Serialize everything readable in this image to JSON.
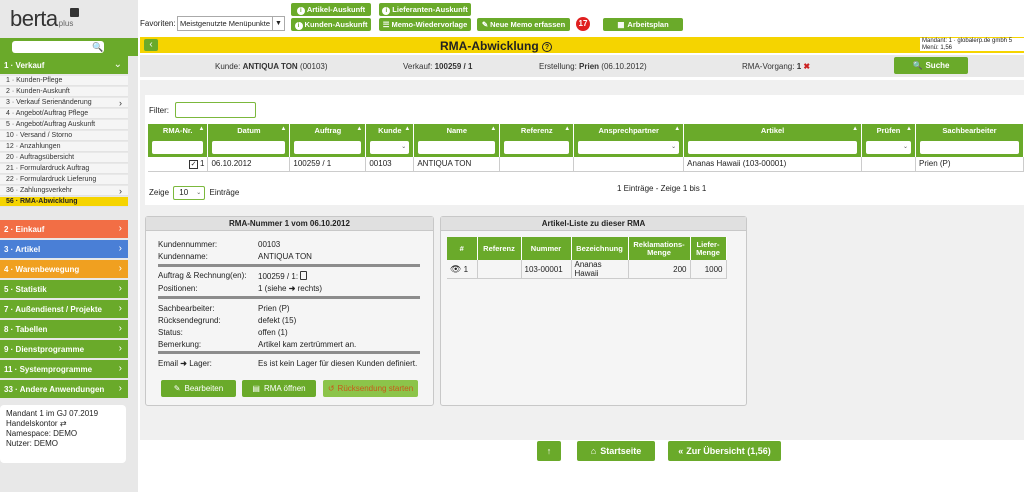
{
  "logo": {
    "text": "berta",
    "suffix": "plus"
  },
  "sidebar": {
    "sections": [
      {
        "label": "1 · Verkauf",
        "color": "#6aaa2a",
        "expanded": true
      },
      {
        "label": "2 · Einkauf",
        "color": "#f26e45"
      },
      {
        "label": "3 · Artikel",
        "color": "#4a7fd6"
      },
      {
        "label": "4 · Warenbewegung",
        "color": "#f0a020"
      },
      {
        "label": "5 · Statistik",
        "color": "#6aaa2a"
      },
      {
        "label": "7 · Außendienst / Projekte",
        "color": "#6aaa2a"
      },
      {
        "label": "8 · Tabellen",
        "color": "#6aaa2a"
      },
      {
        "label": "9 · Dienstprogramme",
        "color": "#6aaa2a"
      },
      {
        "label": "11 · Systemprogramme",
        "color": "#6aaa2a"
      },
      {
        "label": "33 · Andere Anwendungen",
        "color": "#6aaa2a"
      }
    ],
    "items": [
      {
        "label": "1 · Kunden-Pflege"
      },
      {
        "label": "2 · Kunden-Auskunft"
      },
      {
        "label": "3 · Verkauf Serienänderung",
        "chevron": true
      },
      {
        "label": "4 · Angebot/Auftrag Pflege"
      },
      {
        "label": "5 · Angebot/Auftrag Auskunft"
      },
      {
        "label": "10 · Versand / Storno"
      },
      {
        "label": "12 · Anzahlungen"
      },
      {
        "label": "20 · Auftragsübersicht"
      },
      {
        "label": "21 · Formulardruck Auftrag"
      },
      {
        "label": "22 · Formulardruck Lieferung"
      },
      {
        "label": "36 · Zahlungsverkehr",
        "chevron": true
      },
      {
        "label": "56 · RMA-Abwicklung",
        "active": true
      }
    ],
    "user": {
      "line1": "Mandant 1 im GJ 07.2019",
      "line2": "Handelskontor",
      "line3": "Namespace: DEMO",
      "line4": "Nutzer: DEMO"
    }
  },
  "topbar": {
    "favoriten_label": "Favoriten:",
    "favoriten_value": "Meistgenutzte Menüpunkte",
    "btn_artikel": "Artikel-Auskunft",
    "btn_lieferanten": "Lieferanten-Auskunft",
    "btn_kunden": "Kunden-Auskunft",
    "btn_memo_wv": "Memo-Wiedervorlage",
    "btn_neue_memo": "Neue Memo erfassen",
    "memo_badge": "17",
    "btn_arbeitsplan": "Arbeitsplan"
  },
  "titlebar": {
    "title": "RMA-Abwicklung",
    "mandant_line1": "Mandant: 1 · globalerp.de gmbh 5",
    "mandant_line2": "Menü: 1,56"
  },
  "infobar": {
    "kunde_label": "Kunde:",
    "kunde_value": "ANTIQUA TON",
    "kunde_nr": "(00103)",
    "verkauf_label": "Verkauf:",
    "verkauf_value": "100259 / 1",
    "erstellung_label": "Erstellung:",
    "erstellung_value": "Prien",
    "erstellung_date": "(06.10.2012)",
    "rma_label": "RMA-Vorgang:",
    "rma_value": "1",
    "suche": "Suche"
  },
  "grid": {
    "filter_label": "Filter:",
    "columns": [
      "RMA-Nr.",
      "Datum",
      "Auftrag",
      "Kunde",
      "Name",
      "Referenz",
      "Ansprechpartner",
      "Artikel",
      "Prüfen",
      "Sachbearbeiter"
    ],
    "rows": [
      {
        "rma": "1",
        "datum": "06.10.2012",
        "auftrag": "100259 / 1",
        "kunde": "00103",
        "name": "ANTIQUA TON",
        "referenz": "",
        "ansprech": "",
        "artikel": "Ananas Hawaii (103-00001)",
        "pruefen": "",
        "sach": "Prien (P)"
      }
    ],
    "zeige_label": "Zeige",
    "zeige_value": "10",
    "eintraege_label": "Einträge",
    "info": "1 Einträge - Zeige 1 bis 1"
  },
  "rma_panel": {
    "title": "RMA-Nummer 1 vom 06.10.2012",
    "kundennummer_label": "Kundennummer:",
    "kundennummer": "00103",
    "kundenname_label": "Kundenname:",
    "kundenname": "ANTIQUA TON",
    "auftrag_label": "Auftrag & Rechnung(en):",
    "auftrag": "100259 / 1:",
    "positionen_label": "Positionen:",
    "positionen": "1 (siehe",
    "positionen_suffix": "rechts)",
    "sachbearbeiter_label": "Sachbearbeiter:",
    "sachbearbeiter": "Prien (P)",
    "grund_label": "Rücksendegrund:",
    "grund": "defekt (15)",
    "status_label": "Status:",
    "status": "offen (1)",
    "bemerkung_label": "Bemerkung:",
    "bemerkung": "Artikel kam zertrümmert an.",
    "email_label": "Email",
    "email_suffix": "Lager:",
    "email_value": "Es ist kein Lager für diesen Kunden definiert.",
    "btn_bearbeiten": "Bearbeiten",
    "btn_rma": "RMA öffnen",
    "btn_disabled": "Rücksendung starten"
  },
  "artikel_panel": {
    "title": "Artikel-Liste zu dieser RMA",
    "columns": [
      "#",
      "Referenz",
      "Nummer",
      "Bezeichnung",
      "Reklamations-Menge",
      "Liefer-Menge"
    ],
    "rows": [
      {
        "nr": "1",
        "referenz": "",
        "nummer": "103-00001",
        "bezeichnung": "Ananas Hawaii",
        "reklamation": "200",
        "liefer": "1000"
      }
    ]
  },
  "bottom": {
    "startseite": "Startseite",
    "uebersicht": "Zur Übersicht (1,56)"
  }
}
